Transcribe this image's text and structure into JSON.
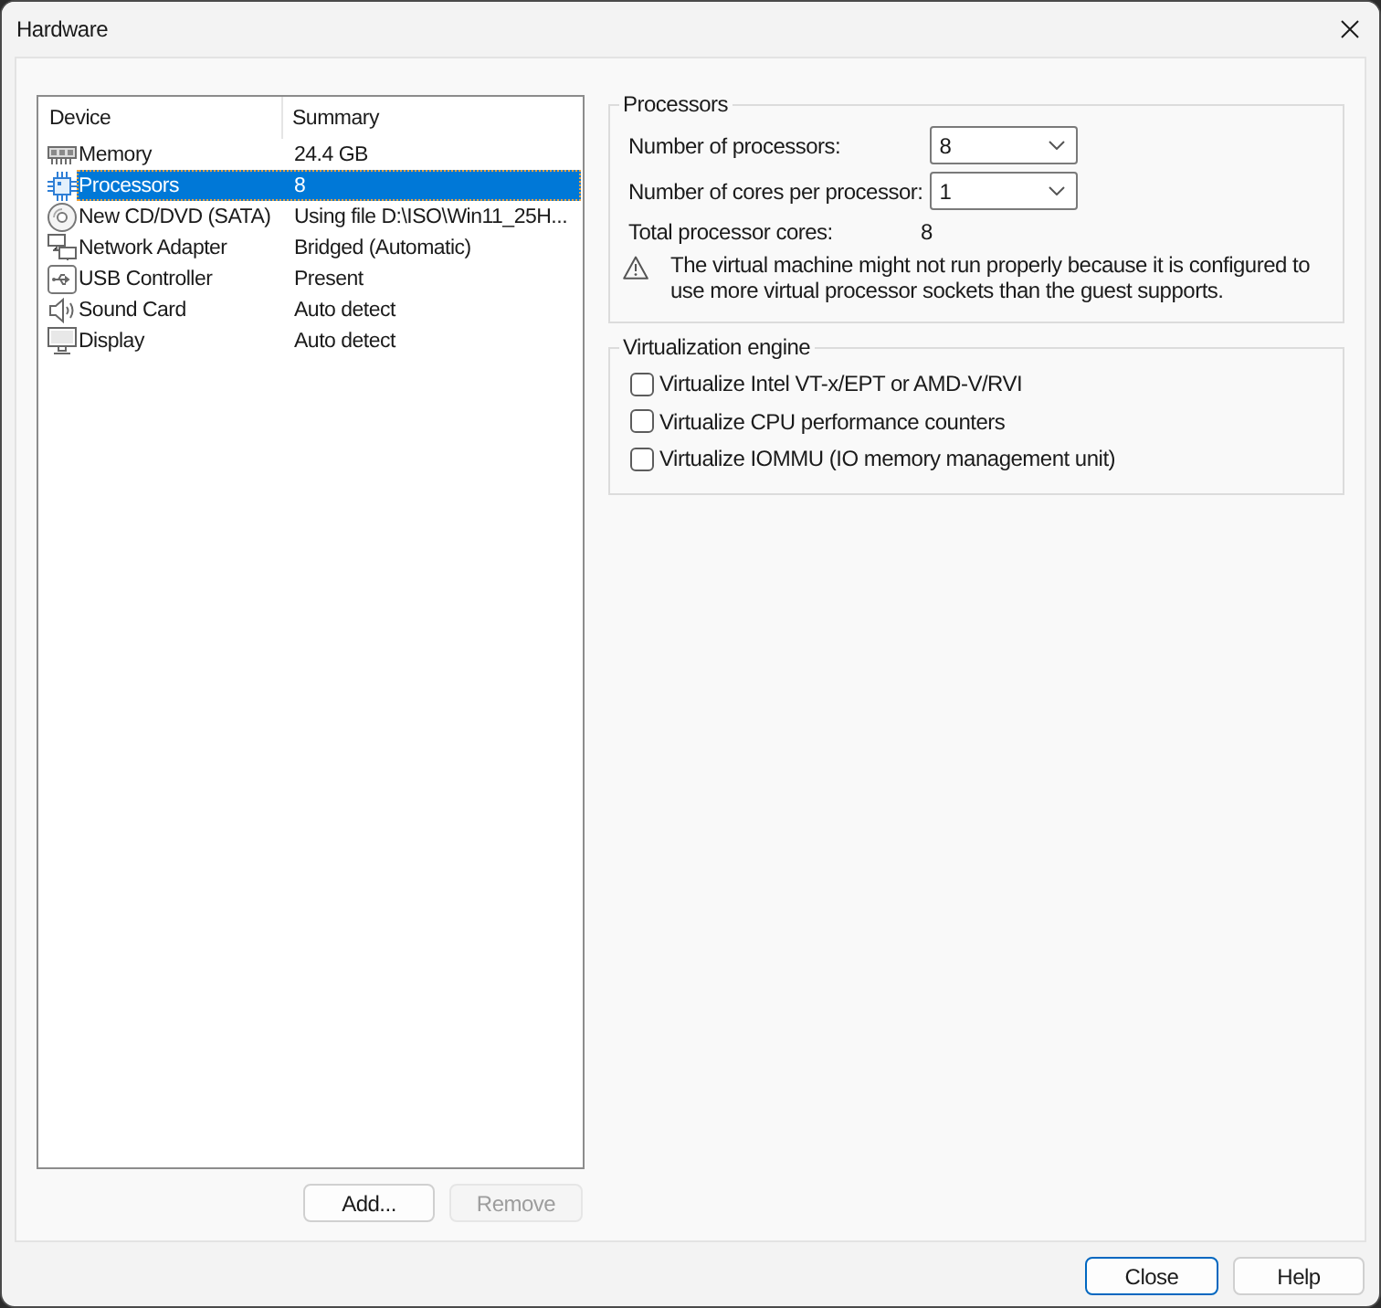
{
  "window": {
    "title": "Hardware"
  },
  "device_list": {
    "columns": [
      "Device",
      "Summary"
    ],
    "rows": [
      {
        "kind": "memory",
        "device": "Memory",
        "summary": "24.4 GB",
        "selected": false
      },
      {
        "kind": "processor",
        "device": "Processors",
        "summary": "8",
        "selected": true
      },
      {
        "kind": "cd_dvd",
        "device": "New CD/DVD (SATA)",
        "summary": "Using file D:\\ISO\\Win11_25H...",
        "selected": false
      },
      {
        "kind": "network",
        "device": "Network Adapter",
        "summary": "Bridged (Automatic)",
        "selected": false
      },
      {
        "kind": "usb",
        "device": "USB Controller",
        "summary": "Present",
        "selected": false
      },
      {
        "kind": "sound",
        "device": "Sound Card",
        "summary": "Auto detect",
        "selected": false
      },
      {
        "kind": "display",
        "device": "Display",
        "summary": "Auto detect",
        "selected": false
      }
    ]
  },
  "list_buttons": [
    {
      "label": "Add...",
      "disabled": false
    },
    {
      "label": "Remove",
      "disabled": true
    }
  ],
  "processors": {
    "title": "Processors",
    "fields": [
      {
        "label": "Number of processors:",
        "value": "8"
      },
      {
        "label": "Number of cores per processor:",
        "value": "1"
      }
    ],
    "total": {
      "label": "Total processor cores:",
      "value": "8"
    },
    "warning": "The virtual machine might not run properly because it is configured to use more virtual processor sockets than the guest supports."
  },
  "virtualization_engine": {
    "title": "Virtualization engine",
    "options": [
      {
        "label": "Virtualize Intel VT-x/EPT or AMD-V/RVI",
        "checked": false
      },
      {
        "label": "Virtualize CPU performance counters",
        "checked": false
      },
      {
        "label": "Virtualize IOMMU (IO memory management unit)",
        "checked": false
      }
    ]
  },
  "dialog_buttons": [
    {
      "label": "Close",
      "default": true
    },
    {
      "label": "Help",
      "default": false
    }
  ]
}
